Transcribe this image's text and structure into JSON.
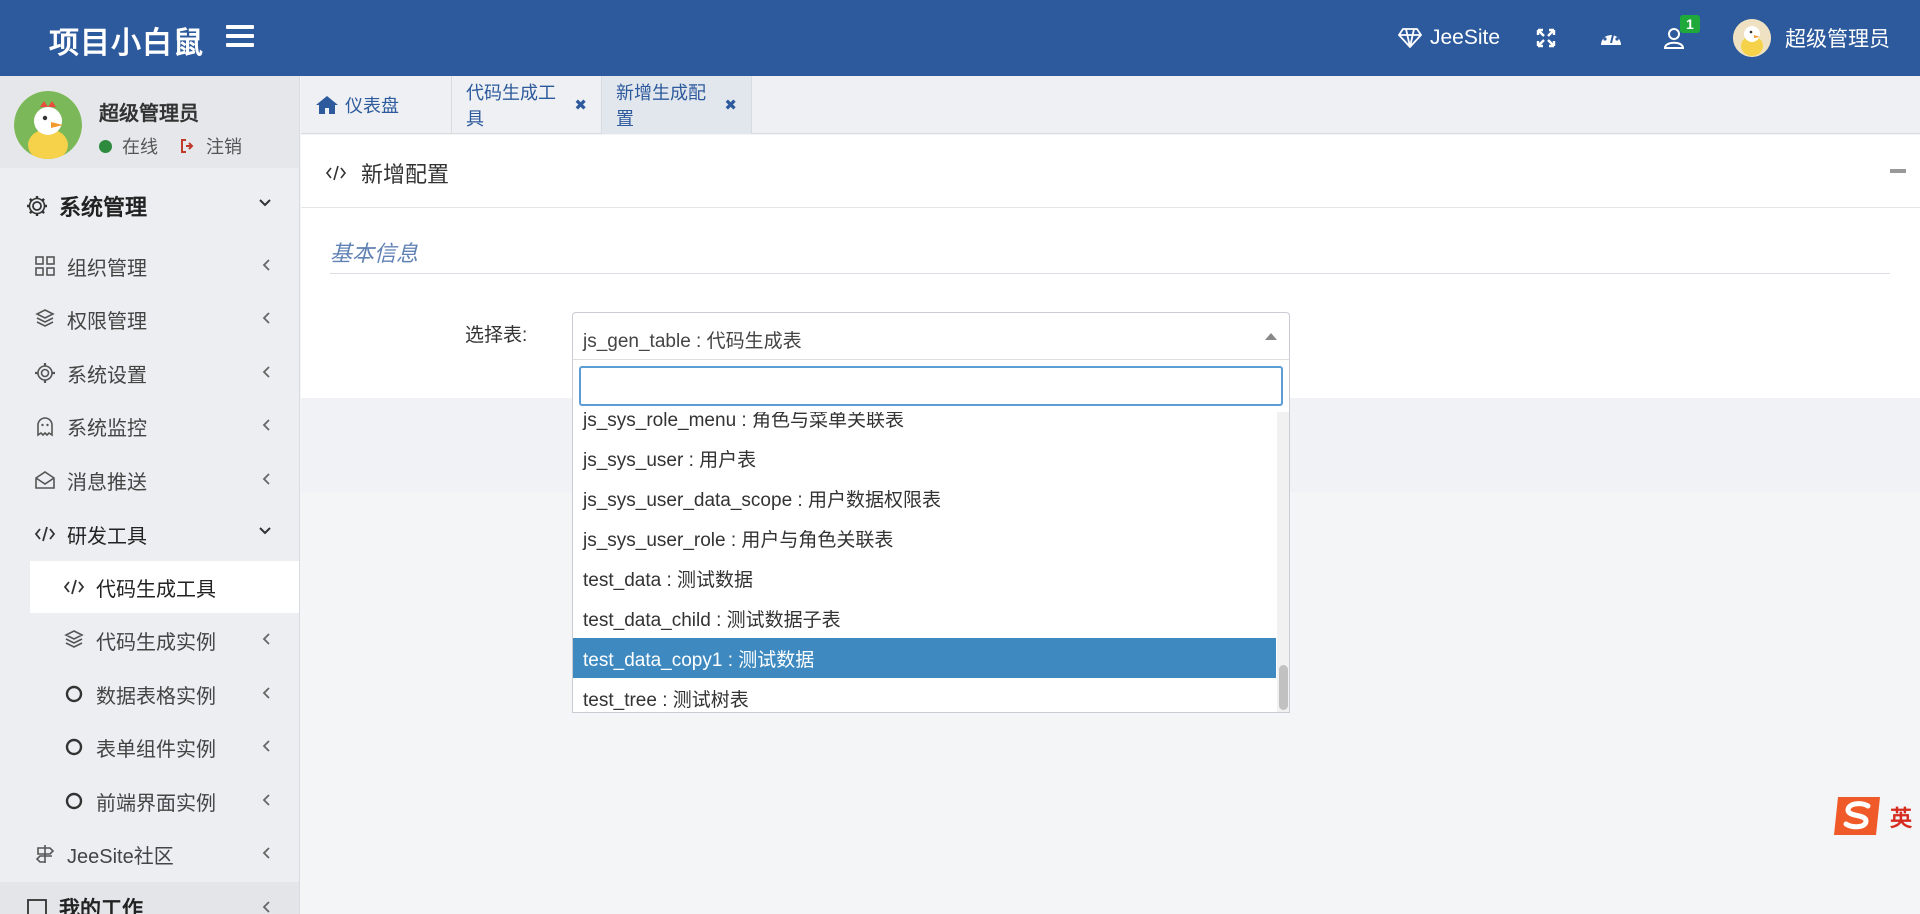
{
  "header": {
    "brand": "项目小白鼠",
    "jeesite_label": "JeeSite",
    "notification_count": "1",
    "user_name": "超级管理员"
  },
  "sidebar": {
    "user_name": "超级管理员",
    "status_online": "在线",
    "logout": "注销",
    "items": [
      {
        "label": "系统管理",
        "icon": "gear-icon"
      },
      {
        "label": "组织管理",
        "icon": "grid-icon"
      },
      {
        "label": "权限管理",
        "icon": "cubes-icon"
      },
      {
        "label": "系统设置",
        "icon": "gear-icon"
      },
      {
        "label": "系统监控",
        "icon": "ghost-icon"
      },
      {
        "label": "消息推送",
        "icon": "envelope-icon"
      },
      {
        "label": "研发工具",
        "icon": "code-icon"
      },
      {
        "label": "代码生成工具",
        "icon": "code-icon"
      },
      {
        "label": "代码生成实例",
        "icon": "cubes-icon"
      },
      {
        "label": "数据表格实例",
        "icon": "circle-icon"
      },
      {
        "label": "表单组件实例",
        "icon": "circle-icon"
      },
      {
        "label": "前端界面实例",
        "icon": "circle-icon"
      },
      {
        "label": "JeeSite社区",
        "icon": "signpost-icon"
      },
      {
        "label": "我的工作",
        "icon": "square-icon"
      }
    ]
  },
  "tabs": [
    {
      "label": "仪表盘"
    },
    {
      "label": "代码生成工具"
    },
    {
      "label": "新增生成配置"
    }
  ],
  "panel": {
    "title": "新增配置",
    "section_title": "基本信息",
    "field_label": "选择表:",
    "selected_value": "js_gen_table : 代码生成表"
  },
  "dropdown": {
    "search_value": "",
    "options": [
      "js_sys_role_menu : 角色与菜单关联表",
      "js_sys_user : 用户表",
      "js_sys_user_data_scope : 用户数据权限表",
      "js_sys_user_role : 用户与角色关联表",
      "test_data : 测试数据",
      "test_data_child : 测试数据子表",
      "test_data_copy1 : 测试数据",
      "test_tree : 测试树表"
    ],
    "highlighted_index": 6
  },
  "ime": {
    "label": "英"
  },
  "colors": {
    "header_bg": "#2d5a9c",
    "highlight": "#3d89c0",
    "online": "#2e8b3e",
    "badge": "#1ea93a"
  }
}
